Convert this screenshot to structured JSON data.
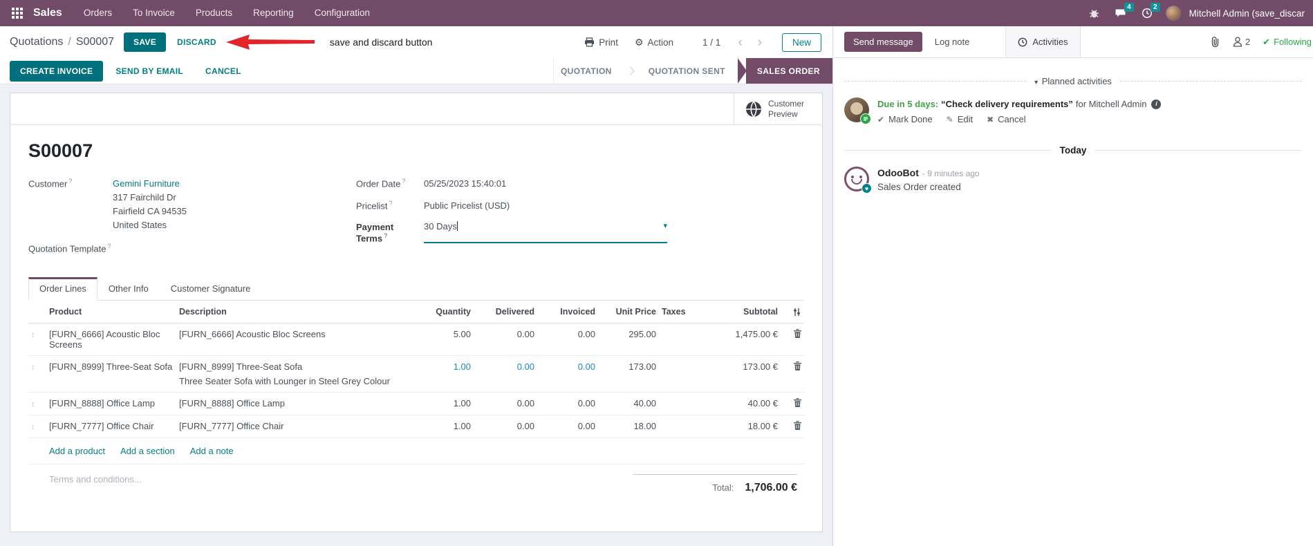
{
  "colors": {
    "navbar_purple": "#714B67",
    "accent_teal": "#017E84",
    "button_teal": "#00717C",
    "active_stage_purple": "#714B67",
    "highlight_blue": "#1789C0",
    "success_green": "#28A745",
    "due_green": "#45A049",
    "annotation_red": "#E3242B",
    "badge_teal": "#12909B"
  },
  "topbar": {
    "app_name": "Sales",
    "menus": [
      "Orders",
      "To Invoice",
      "Products",
      "Reporting",
      "Configuration"
    ],
    "chat_badge": "4",
    "activity_badge": "2",
    "user_name": "Mitchell Admin (save_discar"
  },
  "control_panel": {
    "breadcrumb_parent": "Quotations",
    "breadcrumb_separator": "/",
    "breadcrumb_current": "S00007",
    "save": "SAVE",
    "discard": "DISCARD",
    "annotation": "save and discard button",
    "print": "Print",
    "action": "Action",
    "pager": "1 / 1",
    "new": "New"
  },
  "statusbar": {
    "create_invoice": "CREATE INVOICE",
    "send_by_email": "SEND BY EMAIL",
    "cancel": "CANCEL",
    "stages": [
      "QUOTATION",
      "QUOTATION SENT",
      "SALES ORDER"
    ],
    "active_stage": "SALES ORDER"
  },
  "sheet": {
    "customer_preview": "Customer Preview",
    "title": "S00007",
    "help_marker": "?",
    "fields": {
      "customer_label": "Customer",
      "customer_name": "Gemini Furniture",
      "address_line1": "317 Fairchild Dr",
      "address_line2": "Fairfield CA 94535",
      "address_line3": "United States",
      "quotation_template_label": "Quotation Template",
      "order_date_label": "Order Date",
      "order_date": "05/25/2023 15:40:01",
      "pricelist_label": "Pricelist",
      "pricelist": "Public Pricelist (USD)",
      "payment_terms_label": "Payment Terms",
      "payment_terms": "30 Days"
    },
    "tabs": [
      "Order Lines",
      "Other Info",
      "Customer Signature"
    ],
    "table": {
      "columns": [
        "Product",
        "Description",
        "Quantity",
        "Delivered",
        "Invoiced",
        "Unit Price",
        "Taxes",
        "Subtotal"
      ],
      "rows": [
        {
          "product": "[FURN_6666] Acoustic Bloc Screens",
          "description": "[FURN_6666] Acoustic Bloc Screens",
          "description2": "",
          "quantity": "5.00",
          "delivered": "0.00",
          "invoiced": "0.00",
          "unit_price": "295.00",
          "taxes": "",
          "subtotal": "1,475.00 €"
        },
        {
          "product": "[FURN_8999] Three-Seat Sofa",
          "description": "[FURN_8999] Three-Seat Sofa",
          "description2": "Three Seater Sofa with Lounger in Steel Grey Colour",
          "quantity": "1.00",
          "delivered": "0.00",
          "invoiced": "0.00",
          "unit_price": "173.00",
          "taxes": "",
          "subtotal": "173.00 €"
        },
        {
          "product": "[FURN_8888] Office Lamp",
          "description": "[FURN_8888] Office Lamp",
          "description2": "",
          "quantity": "1.00",
          "delivered": "0.00",
          "invoiced": "0.00",
          "unit_price": "40.00",
          "taxes": "",
          "subtotal": "40.00 €"
        },
        {
          "product": "[FURN_7777] Office Chair",
          "description": "[FURN_7777] Office Chair",
          "description2": "",
          "quantity": "1.00",
          "delivered": "0.00",
          "invoiced": "0.00",
          "unit_price": "18.00",
          "taxes": "",
          "subtotal": "18.00 €"
        }
      ],
      "links": [
        "Add a product",
        "Add a section",
        "Add a note"
      ]
    },
    "terms_placeholder": "Terms and conditions...",
    "total_label": "Total:",
    "total_value": "1,706.00 €"
  },
  "chatter": {
    "send_message": "Send message",
    "log_note": "Log note",
    "activities": "Activities",
    "followers_count": "2",
    "following": "Following",
    "planned_activities": "Planned activities",
    "activity": {
      "due": "Due in 5 days:",
      "summary": "“Check delivery requirements”",
      "assignee": "for Mitchell Admin",
      "mark_done": "Mark Done",
      "edit": "Edit",
      "cancel": "Cancel"
    },
    "today": "Today",
    "message": {
      "author": "OdooBot",
      "time": "- 9 minutes ago",
      "body": "Sales Order created"
    }
  },
  "icons_text": {
    "prev": "‹",
    "next": "›",
    "gear": "⚙",
    "caret_down": "▾",
    "check": "✔",
    "pencil": "✎",
    "cross": "✖",
    "heart": "♥",
    "info": "i",
    "drag": "↕",
    "collapse_caret": "▾"
  }
}
